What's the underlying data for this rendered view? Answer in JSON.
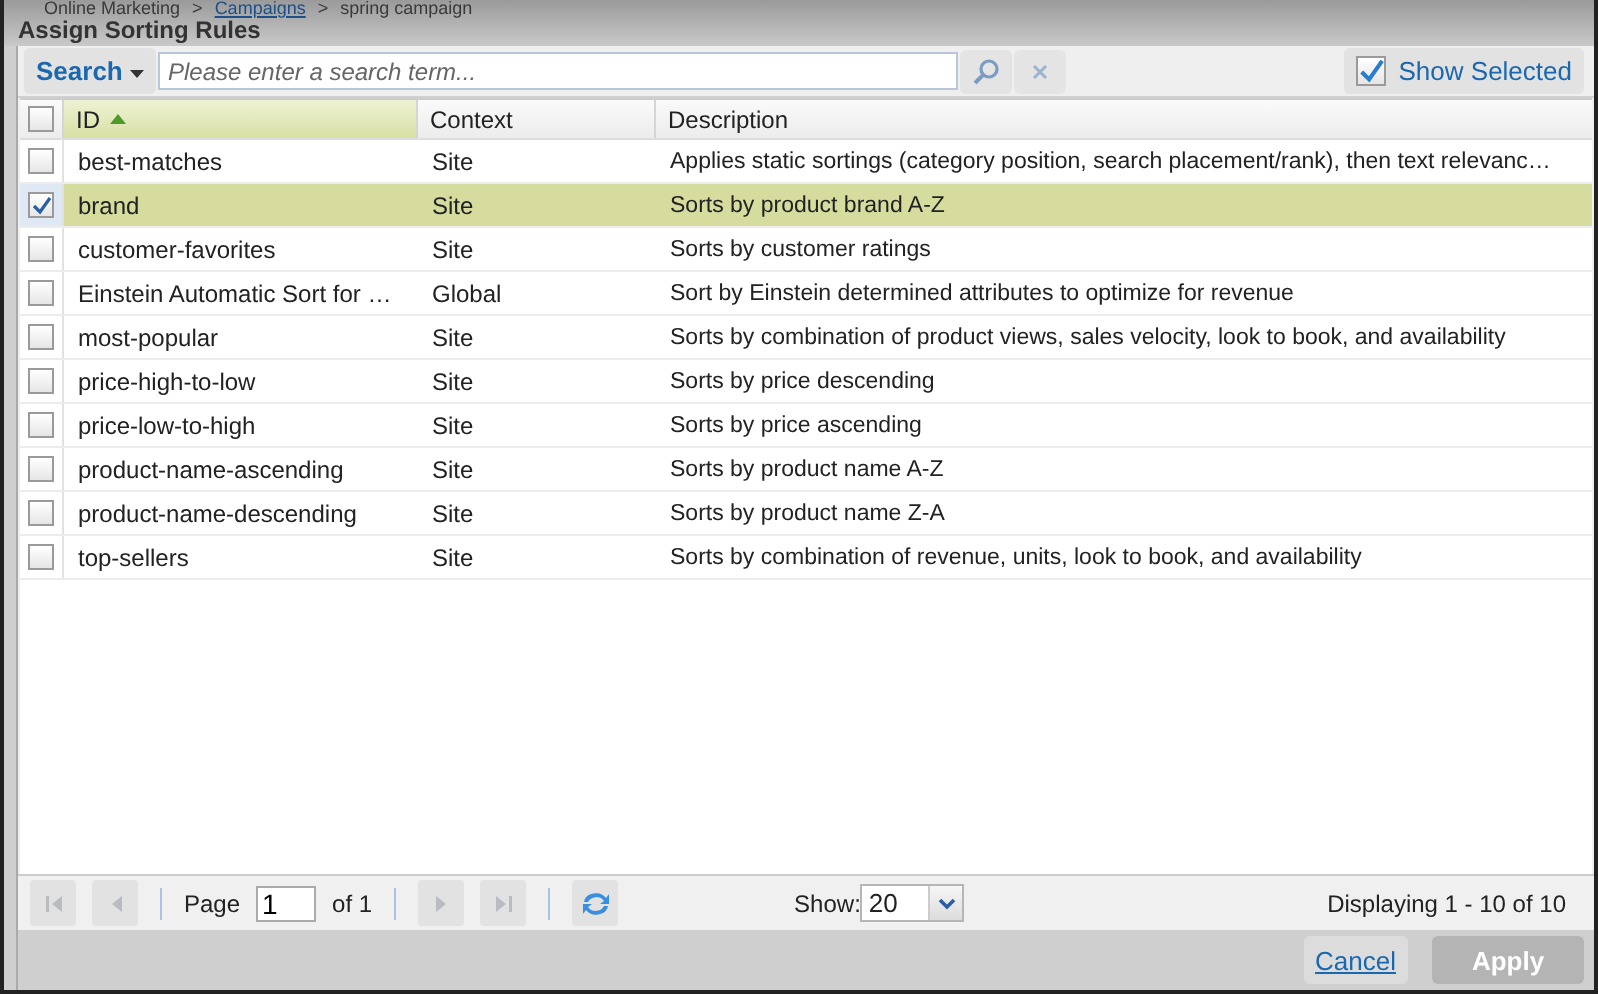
{
  "breadcrumb": [
    "Online Marketing",
    ">",
    "Campaigns",
    ">",
    "spring campaign"
  ],
  "window": {
    "title": "Assign Sorting Rules"
  },
  "toolbar": {
    "search_menu": "Search",
    "search": {
      "placeholder": "Please enter a search term..."
    },
    "show_selected": {
      "label": "Show Selected",
      "checked": true
    }
  },
  "table": {
    "all_checked": false,
    "columns": [
      {
        "label": "ID",
        "sorted": true
      },
      {
        "label": "Context",
        "sorted": false
      },
      {
        "label": "Description",
        "sorted": false
      }
    ],
    "rows": [
      {
        "id": "best-matches",
        "context": "Site",
        "description": "Applies static sortings (category position, search placement/rank), then text relevanc…",
        "selected": false
      },
      {
        "id": "brand",
        "context": "Site",
        "description": "Sorts by product brand A-Z",
        "selected": true
      },
      {
        "id": "customer-favorites",
        "context": "Site",
        "description": "Sorts by customer ratings",
        "selected": false
      },
      {
        "id": "Einstein Automatic Sort for …",
        "context": "Global",
        "description": "Sort by Einstein determined attributes to optimize for revenue",
        "selected": false
      },
      {
        "id": "most-popular",
        "context": "Site",
        "description": "Sorts by combination of product views, sales velocity, look to book, and availability",
        "selected": false
      },
      {
        "id": "price-high-to-low",
        "context": "Site",
        "description": "Sorts by price descending",
        "selected": false
      },
      {
        "id": "price-low-to-high",
        "context": "Site",
        "description": "Sorts by price ascending",
        "selected": false
      },
      {
        "id": "product-name-ascending",
        "context": "Site",
        "description": "Sorts by product name A-Z",
        "selected": false
      },
      {
        "id": "product-name-descending",
        "context": "Site",
        "description": "Sorts by product name Z-A",
        "selected": false
      },
      {
        "id": "top-sellers",
        "context": "Site",
        "description": "Sorts by combination of revenue, units, look to book, and availability",
        "selected": false
      }
    ]
  },
  "pager": {
    "page_label": "Page",
    "page": "1",
    "of": "of 1",
    "show_label": "Show:",
    "page_size": "20",
    "displaying": "Displaying 1 - 10 of 10"
  },
  "buttons": [
    {
      "label": "Cancel",
      "kind": "link",
      "disabled": false
    },
    {
      "label": "Apply",
      "kind": "button",
      "disabled": true
    }
  ]
}
